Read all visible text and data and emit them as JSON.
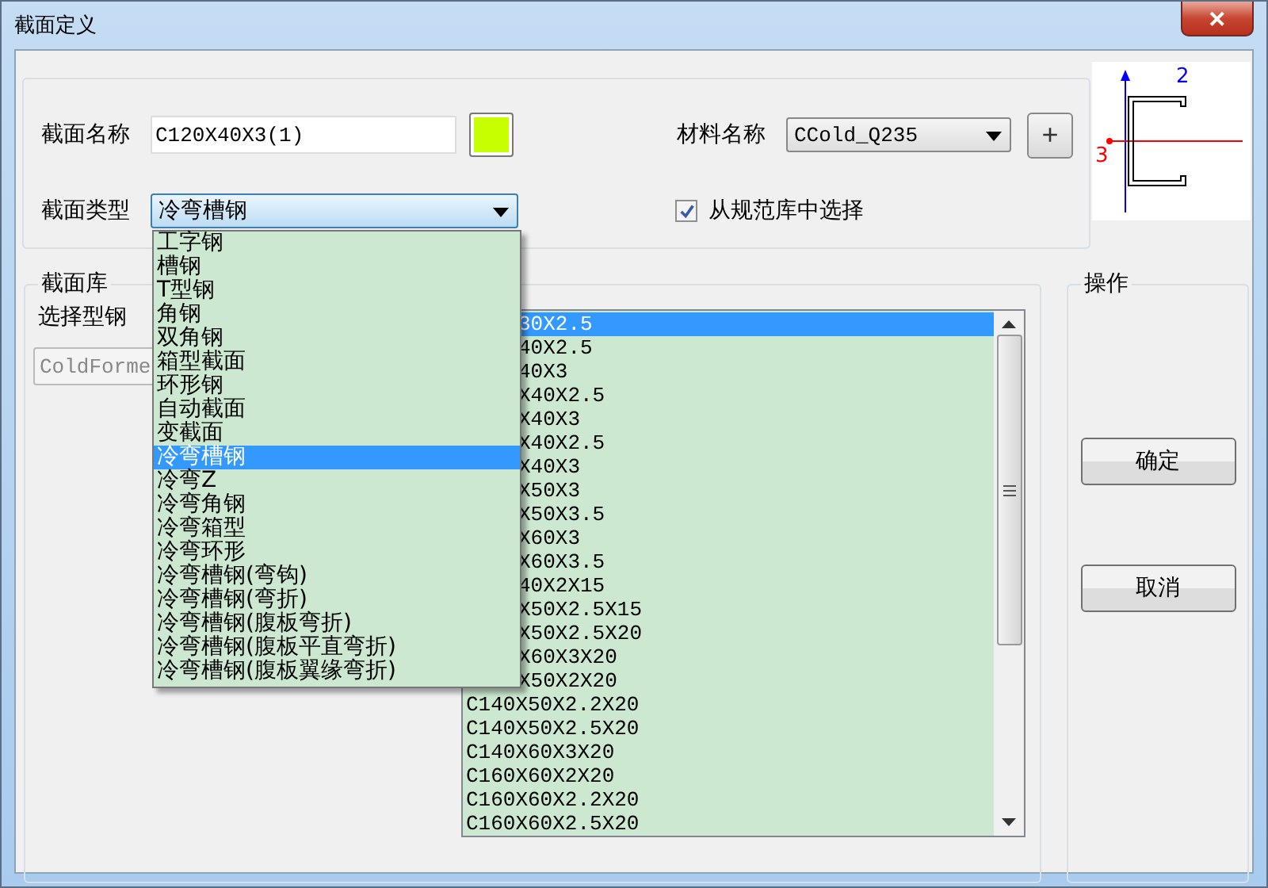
{
  "window": {
    "title": "截面定义",
    "close": "✕"
  },
  "section": {
    "name_label": "截面名称",
    "name_value": "C120X40X3(1)",
    "color": "#c8ff00",
    "type_label": "截面类型",
    "type_value": "冷弯槽钢",
    "material_label": "材料名称",
    "material_value": "CCold_Q235",
    "add_button": "+",
    "from_library": {
      "label": "从规范库中选择",
      "checked": true
    }
  },
  "preview": {
    "axis_2": "2",
    "axis_3": "3"
  },
  "library": {
    "title": "截面库",
    "select_label": "选择型钢",
    "library_value": "ColdForme",
    "library_disabled": true,
    "rows": [
      {
        "text": "30X2.5",
        "selected": true,
        "covered": true
      },
      {
        "text": "40X2.5",
        "selected": false,
        "covered": true
      },
      {
        "text": "40X3",
        "selected": false,
        "covered": true
      },
      {
        "text": "X40X2.5",
        "selected": false,
        "covered": true
      },
      {
        "text": "X40X3",
        "selected": false,
        "covered": true
      },
      {
        "text": "X40X2.5",
        "selected": false,
        "covered": true
      },
      {
        "text": "X40X3",
        "selected": false,
        "covered": true
      },
      {
        "text": "X50X3",
        "selected": false,
        "covered": true
      },
      {
        "text": "X50X3.5",
        "selected": false,
        "covered": true
      },
      {
        "text": "X60X3",
        "selected": false,
        "covered": true
      },
      {
        "text": "X60X3.5",
        "selected": false,
        "covered": true
      },
      {
        "text": "40X2X15",
        "selected": false,
        "covered": true
      },
      {
        "text": "X50X2.5X15",
        "selected": false,
        "covered": true
      },
      {
        "text": "X50X2.5X20",
        "selected": false,
        "covered": true
      },
      {
        "text": "X60X3X20",
        "selected": false,
        "covered": true
      },
      {
        "text": "X50X2X20",
        "selected": false,
        "covered": true
      },
      {
        "text": "C140X50X2.2X20",
        "selected": false,
        "covered": false
      },
      {
        "text": "C140X50X2.5X20",
        "selected": false,
        "covered": false
      },
      {
        "text": "C140X60X3X20",
        "selected": false,
        "covered": false
      },
      {
        "text": "C160X60X2X20",
        "selected": false,
        "covered": false
      },
      {
        "text": "C160X60X2.2X20",
        "selected": false,
        "covered": false
      },
      {
        "text": "C160X60X2.5X20",
        "selected": false,
        "covered": false
      }
    ]
  },
  "operations": {
    "title": "操作",
    "buttons": [
      "确定",
      "取消"
    ]
  },
  "type_dropdown": {
    "options": [
      {
        "label": "工字钢",
        "selected": false
      },
      {
        "label": "槽钢",
        "selected": false
      },
      {
        "label": "T型钢",
        "selected": false
      },
      {
        "label": "角钢",
        "selected": false
      },
      {
        "label": "双角钢",
        "selected": false
      },
      {
        "label": "箱型截面",
        "selected": false
      },
      {
        "label": "环形钢",
        "selected": false
      },
      {
        "label": "自动截面",
        "selected": false
      },
      {
        "label": "变截面",
        "selected": false
      },
      {
        "label": "冷弯槽钢",
        "selected": true
      },
      {
        "label": "冷弯Z",
        "selected": false
      },
      {
        "label": "冷弯角钢",
        "selected": false
      },
      {
        "label": "冷弯箱型",
        "selected": false
      },
      {
        "label": "冷弯环形",
        "selected": false
      },
      {
        "label": "冷弯槽钢(弯钩)",
        "selected": false
      },
      {
        "label": "冷弯槽钢(弯折)",
        "selected": false
      },
      {
        "label": "冷弯槽钢(腹板弯折)",
        "selected": false
      },
      {
        "label": "冷弯槽钢(腹板平直弯折)",
        "selected": false
      },
      {
        "label": "冷弯槽钢(腹板翼缘弯折)",
        "selected": false
      }
    ]
  }
}
